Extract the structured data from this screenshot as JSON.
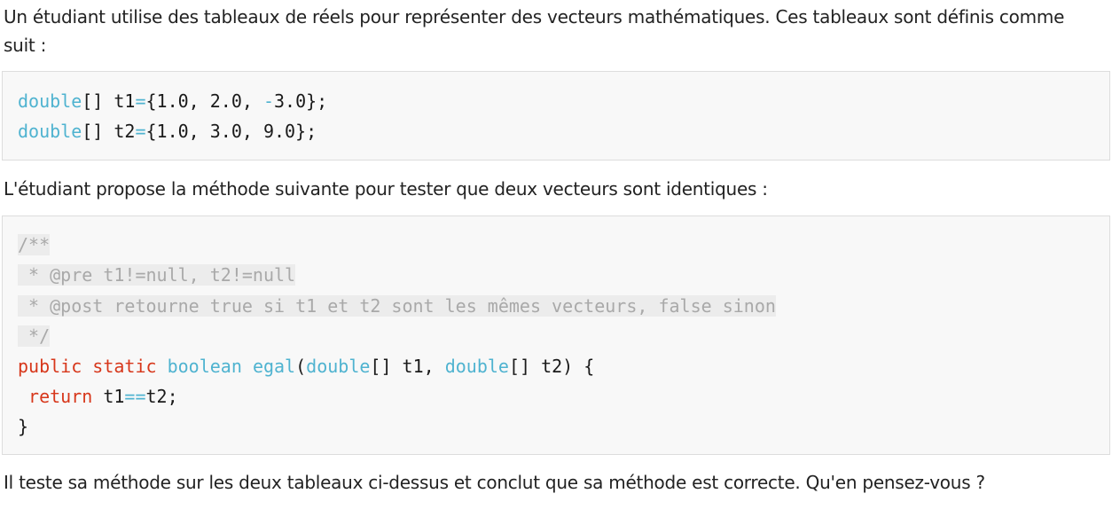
{
  "paragraphs": {
    "intro": "Un étudiant utilise des tableaux de réels pour représenter des vecteurs mathématiques. Ces tableaux sont définis comme suit :",
    "method_intro": "L'étudiant propose la méthode suivante pour tester que deux vecteurs sont identiques :",
    "question": "Il teste sa méthode sur les deux tableaux ci-dessus et conclut que sa méthode est correcte. Qu'en pensez-vous ?"
  },
  "code1": {
    "line1": {
      "type": "double",
      "rest_a": "[] t1",
      "eq": "=",
      "rest_b": "{1.0, 2.0, ",
      "minus": "-",
      "rest_c": "3.0};"
    },
    "line2": {
      "type": "double",
      "rest_a": "[] t2",
      "eq": "=",
      "rest_b": "{1.0, 3.0, 9.0};"
    }
  },
  "code2": {
    "comment1": "/**",
    "comment2": " * @pre t1!=null, t2!=null",
    "comment3": " * @post retourne true si t1 et t2 sont les mêmes vecteurs, false sinon",
    "comment4": " */",
    "sig": {
      "public": "public",
      "static": "static",
      "boolean": "boolean",
      "name": "egal",
      "paren_open": "(",
      "type1": "double",
      "arg1": "[] t1, ",
      "type2": "double",
      "arg2": "[] t2) {"
    },
    "ret": {
      "kw": "return",
      "lhs": " t1",
      "op": "==",
      "rhs": "t2;"
    },
    "close": "}"
  }
}
